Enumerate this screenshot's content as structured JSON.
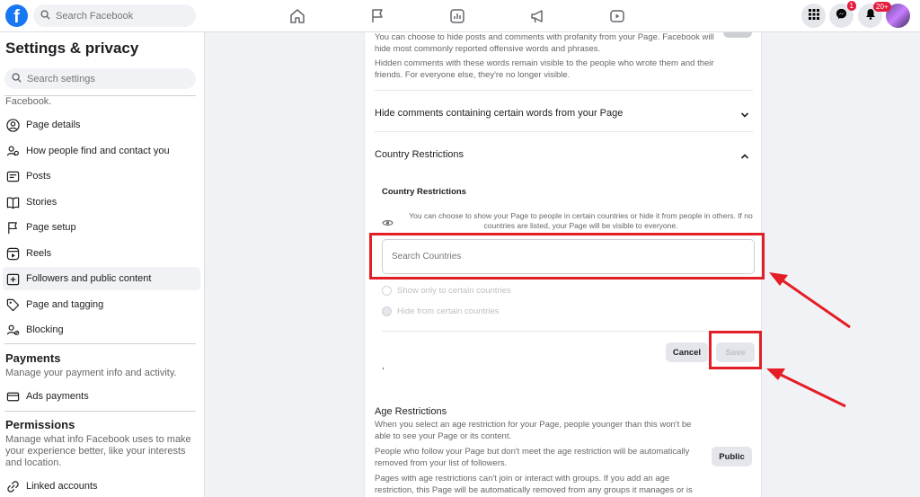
{
  "topbar": {
    "logo": "f",
    "search_placeholder": "Search Facebook",
    "nav_icons": [
      "home-icon",
      "flag-icon",
      "chart-icon",
      "megaphone-icon",
      "video-icon"
    ],
    "messenger_badge": "1",
    "notifications_badge": "20+"
  },
  "sidebar": {
    "title": "Settings & privacy",
    "search_placeholder": "Search settings",
    "truncated_text": "Facebook.",
    "items": [
      {
        "label": "Page details",
        "icon": "user-circle-icon"
      },
      {
        "label": "How people find and contact you",
        "icon": "people-icon"
      },
      {
        "label": "Posts",
        "icon": "posts-icon"
      },
      {
        "label": "Stories",
        "icon": "book-icon"
      },
      {
        "label": "Page setup",
        "icon": "flag-icon"
      },
      {
        "label": "Reels",
        "icon": "reels-icon"
      },
      {
        "label": "Followers and public content",
        "icon": "add-box-icon"
      },
      {
        "label": "Page and tagging",
        "icon": "tag-icon"
      },
      {
        "label": "Blocking",
        "icon": "block-user-icon"
      }
    ],
    "payments": {
      "title": "Payments",
      "desc": "Manage your payment info and activity.",
      "item": "Ads payments"
    },
    "permissions": {
      "title": "Permissions",
      "desc": "Manage what info Facebook uses to make your experience better, like your interests and location.",
      "item": "Linked accounts"
    }
  },
  "main": {
    "profanity_text_1": "You can choose to hide posts and comments with profanity from your Page. Facebook will hide most commonly reported offensive words and phrases.",
    "profanity_text_2": "Hidden comments with these words remain visible to the people who wrote them and their friends. For everyone else, they're no longer visible.",
    "hide_comments_title": "Hide comments containing certain words from your Page",
    "country_section_title": "Country Restrictions",
    "country_label": "Country Restrictions",
    "country_desc": "You can choose to show your Page to people in certain countries or hide it from people in others. If no countries are listed, your Page will be visible to everyone.",
    "country_search_placeholder": "Search Countries",
    "radio_show": "Show only to certain countries",
    "radio_hide": "Hide from certain countries",
    "cancel_label": "Cancel",
    "save_label": "Save",
    "stray_mark": ",",
    "age_title": "Age Restrictions",
    "age_text_1": "When you select an age restriction for your Page, people younger than this won't be able to see your Page or its content.",
    "age_text_2": "People who follow your Page but don't meet the age restriction will be automatically removed from your list of followers.",
    "age_text_3": "Pages with age restrictions can't join or interact with groups. If you add an age restriction, this Page will be automatically removed from any groups it manages or is",
    "public_label": "Public"
  },
  "colors": {
    "brand": "#1877f2",
    "annotation": "#e41e26"
  }
}
